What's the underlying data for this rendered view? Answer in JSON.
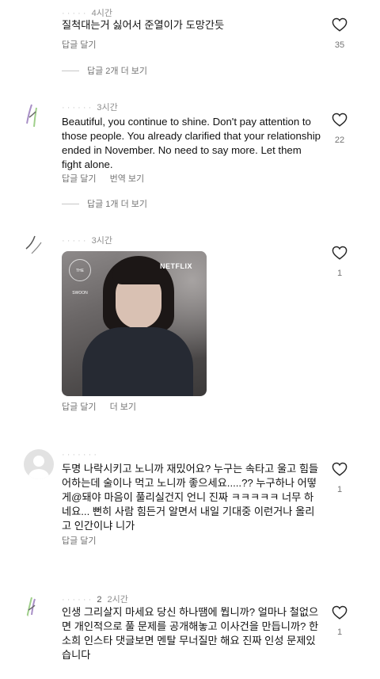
{
  "comments": [
    {
      "username": "",
      "time": "4시간",
      "text": "질척대는거 싫어서 준열이가 도망간듯",
      "reply_label": "답글 달기",
      "like_count": "35",
      "view_replies": "답글 2개 더 보기"
    },
    {
      "username": "",
      "time": "3시간",
      "text": "Beautiful, you continue to shine. Don't pay attention to those people. You already clarified that your relationship ended in November. No need to say more. Let them fight alone.",
      "reply_label": "답글 달기",
      "translate_label": "번역 보기",
      "like_count": "22",
      "view_replies": "답글 1개 더 보기"
    },
    {
      "username": "",
      "time": "3시간",
      "gif_badge": "NETFLIX",
      "gif_logo": "THE SWOON",
      "reply_label": "답글 달기",
      "more_label": "더 보기",
      "like_count": "1"
    },
    {
      "username": "",
      "time": "",
      "text": "두명 나락시키고 노니까 재밌어요? 누구는 속타고 울고 힘들어하는데 술이나 먹고 노니까 좋으세요.....?? 누구하나 어떻게@돼야 마음이 풀리실건지 언니 진짜 ㅋㅋㅋㅋㅋ 너무 하네요... 뻔히 사람 힘든거 알면서 내일 기대중 이런거나 올리고 인간이냐 니가",
      "reply_label": "답글 달기",
      "like_count": "1"
    },
    {
      "username": "2",
      "time": "2시간",
      "text": "인생 그리살지 마세요 당신 하나땜에 뭡니까? 얼마나 철없으면 개인적으로 풀 문제를 공개해놓고 이사건을 만듭니까? 한소희 인스타 댓글보면 멘탈 무너질만 해요 진짜 인성 문제있습니다",
      "like_count": "1"
    }
  ]
}
